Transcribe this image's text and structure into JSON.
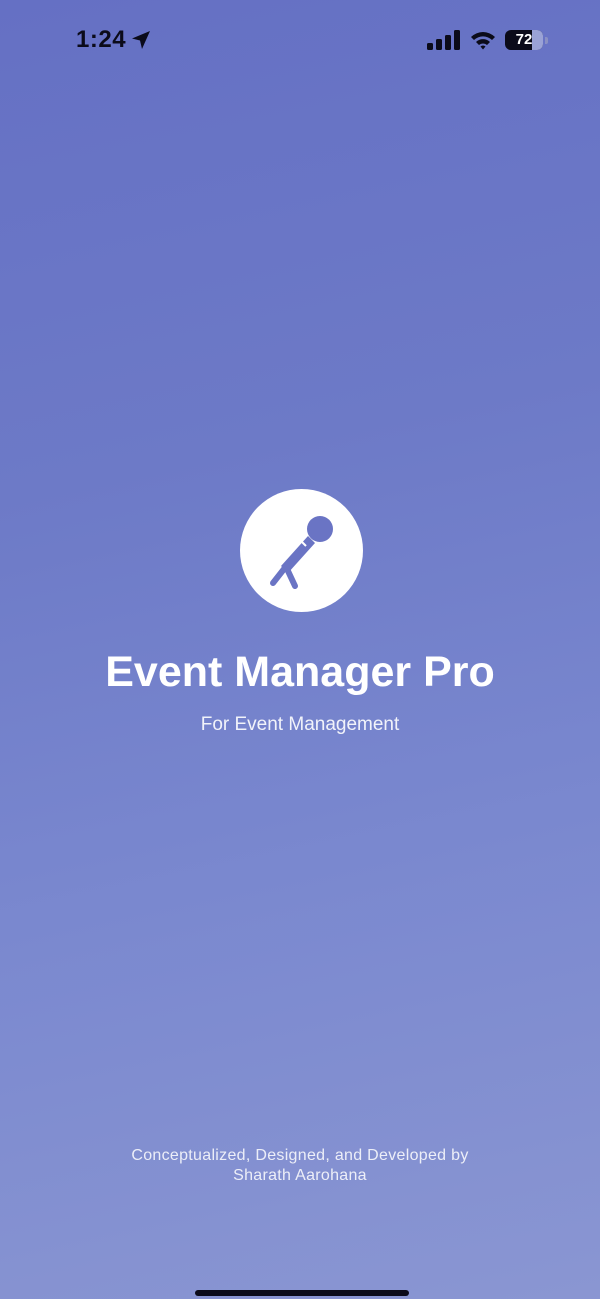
{
  "status_bar": {
    "time": "1:24",
    "battery_level": "72",
    "battery_fraction": 0.72,
    "icons": [
      "location-arrow-icon",
      "cellular-signal-icon",
      "wifi-icon",
      "battery-icon"
    ]
  },
  "splash": {
    "logo_icon": "microphone-icon",
    "title": "Event Manager Pro",
    "subtitle": "For Event Management"
  },
  "footer": {
    "credit_line_1": "Conceptualized, Designed, and Developed by",
    "credit_line_2": "Sharath Aarohana"
  },
  "colors": {
    "background_top": "#6570c4",
    "background_bottom": "#8a96d2",
    "accent": "#6a74c4",
    "foreground": "#ffffff"
  }
}
